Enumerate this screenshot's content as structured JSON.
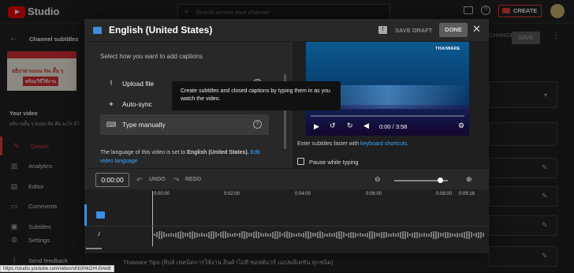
{
  "app": {
    "logo_text": "Studio",
    "search_placeholder": "Search across your channel",
    "create_label": "CREATE"
  },
  "sidebar": {
    "heading": "Channel subtitles",
    "video_heading": "Your video",
    "video_desc": "อธิบายสั้น ๆ hosts file คือ อะไร มีไว้ทำ...",
    "thumb_line1": "อธิบาย hosts file สั้น ๆ",
    "thumb_line2": "พร้อมวิธีใช้งาน",
    "items": [
      {
        "label": "Details",
        "icon": "pencil-icon"
      },
      {
        "label": "Analytics",
        "icon": "bar-chart-icon"
      },
      {
        "label": "Editor",
        "icon": "film-icon"
      },
      {
        "label": "Comments",
        "icon": "comment-icon"
      },
      {
        "label": "Subtitles",
        "icon": "subtitles-icon"
      }
    ],
    "settings": "Settings",
    "feedback": "Send feedback"
  },
  "background": {
    "changes_label": "CHANGES",
    "save_label": "SAVE",
    "bottom_title": "Thaiware Tips (ทิปส์ เทคนิคการใช้งาน สินค้าไอที ซอฟต์แวร์ แอปพลิเคชัน ทุกชนิด)"
  },
  "modal": {
    "title": "English (United States)",
    "save_draft": "SAVE DRAFT",
    "done": "DONE",
    "prompt": "Select how you want to add captions",
    "options": [
      {
        "label": "Upload file",
        "icon": "upload-icon"
      },
      {
        "label": "Auto-sync",
        "icon": "sparkle-icon"
      },
      {
        "label": "Type manually",
        "icon": "keyboard-icon"
      }
    ],
    "tooltip": "Create subtitles and closed captions by typing them in as you watch the video.",
    "language_prefix": "The language of this video is set to ",
    "language_name": "English (United States).",
    "edit_link": "Edit video language",
    "player": {
      "watermark": "THAIWARE",
      "time": "0:00 / 3:58",
      "progress": 0.0
    },
    "shortcuts_prefix": "Enter subtitles faster with ",
    "shortcuts_link": "keyboard shortcuts.",
    "pause_label": "Pause while typing",
    "timeline": {
      "current": "0:00:00",
      "undo": "UNDO",
      "redo": "REDO",
      "zoom_level": 0.85,
      "ticks": [
        "0:00:00",
        "0:02:00",
        "0:04:00",
        "0:06:00",
        "0:08:00",
        "0:09:16"
      ]
    }
  },
  "status_url": "https://studio.youtube.com/video/sKb3Hki2HU0/edit"
}
